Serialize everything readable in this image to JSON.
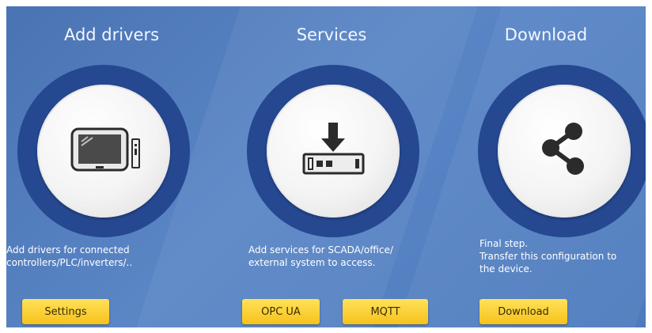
{
  "columns": {
    "drivers": {
      "title": "Add drivers",
      "icon": "monitor-icon",
      "desc_lines": [
        "Add drivers for connected",
        "controllers/PLC/inverters/.."
      ],
      "buttons": [
        "Settings"
      ]
    },
    "services": {
      "title": "Services",
      "icon": "download-to-device-icon",
      "desc_lines": [
        "Add services for SCADA/office/",
        "external system to access."
      ],
      "buttons": [
        "OPC UA",
        "MQTT"
      ]
    },
    "download": {
      "title": "Download",
      "icon": "share-icon",
      "desc_lines": [
        "Final step.",
        "Transfer this configuration to",
        "the device."
      ],
      "buttons": [
        "Download"
      ]
    }
  },
  "colors": {
    "background": "#5a86c6",
    "ring": "#254891",
    "button": "#f6c21a"
  }
}
